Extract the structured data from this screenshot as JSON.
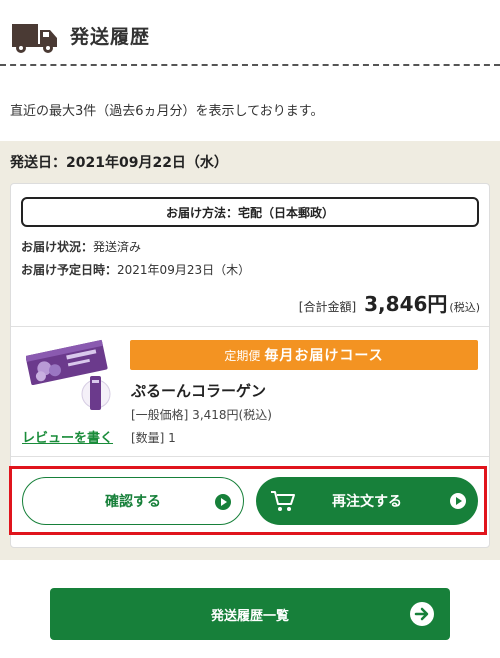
{
  "header": {
    "title": "発送履歴",
    "icon": "truck-icon"
  },
  "notice": "直近の最大3件（過去6ヵ月分）を表示しております。",
  "order": {
    "ship_date": "発送日：2021年09月22日（水）",
    "delivery_method": "お届け方法：宅配（日本郵政）",
    "status_label": "お届け状況：",
    "status_value": "発送済み",
    "eta_label": "お届け予定日時：",
    "eta_value": "2021年09月23日（木）",
    "total_label": "[合計金額]",
    "total_amount": "3,846円",
    "total_tax": "(税込)"
  },
  "product": {
    "course_small": "定期便",
    "course_big": "毎月お届けコース",
    "name": "ぷるーんコラーゲン",
    "price": "[一般価格] 3,418円(税込)",
    "qty": "[数量] 1",
    "review_link": "レビューを書く"
  },
  "actions": {
    "confirm": "確認する",
    "reorder": "再注文する",
    "history_list": "発送履歴一覧"
  },
  "colors": {
    "accent_green": "#17803a",
    "orange": "#f39322",
    "highlight_red": "#e0141c",
    "bg_beige": "#efece1"
  }
}
